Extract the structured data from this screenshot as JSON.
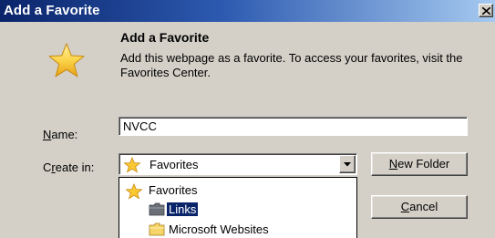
{
  "window": {
    "title": "Add a Favorite"
  },
  "header": {
    "title": "Add a Favorite",
    "description": "Add this webpage as a favorite. To access your favorites, visit the Favorites Center."
  },
  "form": {
    "name_label_accel": "N",
    "name_label_rest": "ame:",
    "name_value": "NVCC",
    "create_label_pre": "C",
    "create_label_accel": "r",
    "create_label_rest": "eate in:",
    "create_selected": "Favorites"
  },
  "buttons": {
    "new_folder_accel": "N",
    "new_folder_rest": "ew Folder",
    "cancel_accel": "C",
    "cancel_rest": "ancel"
  },
  "folder_tree": {
    "items": [
      {
        "label": "Favorites",
        "icon": "favorites-star-icon",
        "selected": false
      },
      {
        "label": "Links",
        "icon": "folder-icon",
        "selected": true
      },
      {
        "label": "Microsoft Websites",
        "icon": "folder-icon",
        "selected": false
      }
    ]
  },
  "colors": {
    "titlebar_start": "#0a246a",
    "titlebar_end": "#a6caf0",
    "dialog_face": "#d4d0c8",
    "selection": "#0a246a",
    "star_yellow": "#f7c624"
  }
}
